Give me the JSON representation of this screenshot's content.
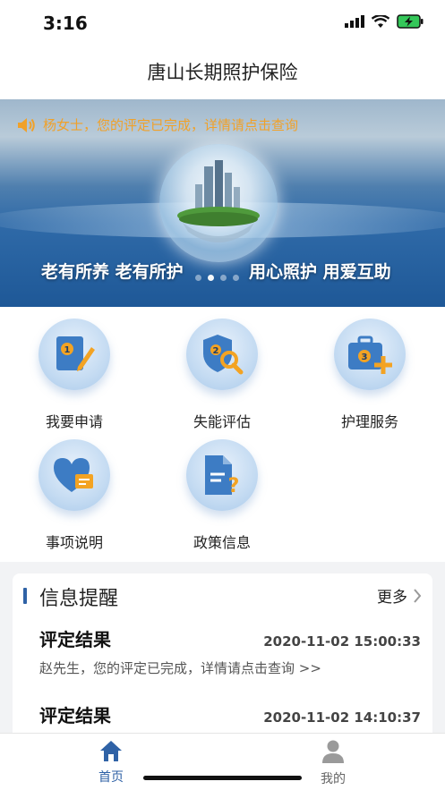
{
  "status_bar": {
    "time": "3:16"
  },
  "app": {
    "title": "唐山长期照护保险"
  },
  "banner": {
    "notice": "杨女士，您的评定已完成，详情请点击查询",
    "slogan_left": "老有所养 老有所护",
    "slogan_right": "用心照护 用爱互助",
    "page_count": 4,
    "active_page": 1
  },
  "services": [
    {
      "label": "我要申请",
      "icon": "apply-document-icon",
      "number": "1"
    },
    {
      "label": "失能评估",
      "icon": "assessment-shield-icon",
      "number": "2"
    },
    {
      "label": "护理服务",
      "icon": "care-kit-icon",
      "number": "3"
    },
    {
      "label": "事项说明",
      "icon": "heart-message-icon"
    },
    {
      "label": "政策信息",
      "icon": "policy-document-icon"
    }
  ],
  "notices": {
    "title": "信息提醒",
    "more_label": "更多",
    "items": [
      {
        "title": "评定结果",
        "time": "2020-11-02 15:00:33",
        "body": "赵先生，您的评定已完成，详情请点击查询  >>"
      },
      {
        "title": "评定结果",
        "time": "2020-11-02 14:10:37"
      }
    ]
  },
  "tabbar": {
    "tabs": [
      {
        "label": "首页",
        "icon": "home-icon",
        "active": true
      },
      {
        "label": "我的",
        "icon": "user-icon",
        "active": false
      }
    ]
  },
  "colors": {
    "accent": "#2f62a6",
    "notice": "#f0a12a",
    "icon_blue": "#3d7cc4",
    "icon_orange": "#f3a323"
  }
}
